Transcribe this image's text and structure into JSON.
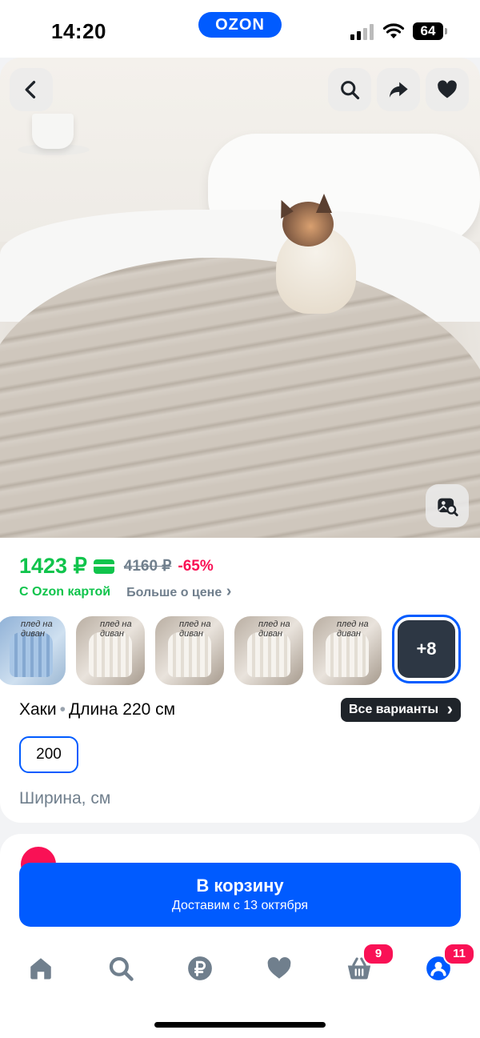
{
  "status_bar": {
    "time": "14:20",
    "logo": "OZON",
    "battery": "64"
  },
  "product": {
    "price": "1423 ₽",
    "old_price": "4160 ₽",
    "discount": "-65%",
    "with_card_text": "С Ozon картой",
    "more_price_text": "Больше о цене",
    "color": "Хаки",
    "length": "Длина 220 см",
    "all_variants_label": "Все варианты",
    "selected_size": "200",
    "width_label": "Ширина, см",
    "thumb_label": "плед на диван",
    "more_variants": "+8"
  },
  "cart_button": {
    "title": "В корзину",
    "subtitle": "Доставим с 13 октября"
  },
  "tabbar": {
    "cart_badge": "9",
    "profile_badge": "11"
  },
  "colors": {
    "accent": "#005bff",
    "price": "#10c44c",
    "discount": "#f91155"
  }
}
